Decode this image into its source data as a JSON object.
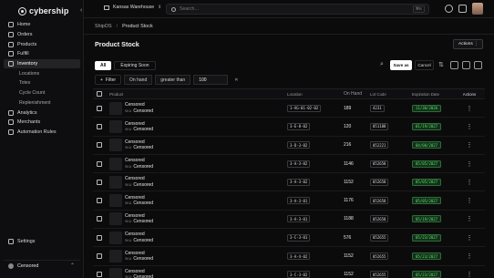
{
  "app": {
    "logo_text": "cybership",
    "collapse_icon": "chevron-left-icon"
  },
  "sidebar": {
    "items": [
      {
        "label": "Home",
        "icon": "home-icon"
      },
      {
        "label": "Orders",
        "icon": "orders-icon"
      },
      {
        "label": "Products",
        "icon": "box-icon"
      },
      {
        "label": "Fulfill",
        "icon": "truck-icon"
      },
      {
        "label": "Inventory",
        "icon": "inventory-icon",
        "active": true
      }
    ],
    "subitems": [
      "Locations",
      "Totes",
      "Cycle Count",
      "Replenishment"
    ],
    "items_after": [
      {
        "label": "Analytics",
        "icon": "analytics-icon"
      },
      {
        "label": "Merchants",
        "icon": "merchants-icon"
      },
      {
        "label": "Automation Rules",
        "icon": "automation-icon"
      }
    ],
    "settings_label": "Settings",
    "user_label": "Censored"
  },
  "topbar": {
    "warehouse": "Kansas Warehouse",
    "search_placeholder": "Search...",
    "shortcut": "⌘K"
  },
  "breadcrumb": {
    "root": "ShipOS",
    "sep": "/",
    "current": "Product Stock"
  },
  "page": {
    "title": "Product Stock",
    "actions_label": "Actions"
  },
  "tabs": [
    "All",
    "Expiring Soon"
  ],
  "toolbar": {
    "save_as": "Save as",
    "cancel": "Cancel"
  },
  "filter": {
    "button_label": "Filter",
    "field": "On hand",
    "operator": "greater than",
    "value": "100"
  },
  "table": {
    "headers": [
      "Product",
      "Location",
      "On Hand",
      "Lot Code",
      "Expiration Date",
      "Actions"
    ],
    "sku_label": "SKU",
    "rows": [
      {
        "name": "Censored",
        "sku": "Censored",
        "location": "1-AG-01-02-02",
        "on_hand": "189",
        "lot": "4231",
        "exp": "11/30/2026"
      },
      {
        "name": "Censored",
        "sku": "Censored",
        "location": "3-E-8-02",
        "on_hand": "120",
        "lot": "051188",
        "exp": "01/19/2027"
      },
      {
        "name": "Censored",
        "sku": "Censored",
        "location": "3-D-3-02",
        "on_hand": "216",
        "lot": "052221",
        "exp": "04/08/2027"
      },
      {
        "name": "Censored",
        "sku": "Censored",
        "location": "3-A-3-02",
        "on_hand": "1146",
        "lot": "052658",
        "exp": "05/05/2027"
      },
      {
        "name": "Censored",
        "sku": "Censored",
        "location": "3-A-3-02",
        "on_hand": "1152",
        "lot": "052658",
        "exp": "05/05/2027"
      },
      {
        "name": "Censored",
        "sku": "Censored",
        "location": "3-A-3-01",
        "on_hand": "1176",
        "lot": "052658",
        "exp": "05/05/2027"
      },
      {
        "name": "Censored",
        "sku": "Censored",
        "location": "3-A-3-01",
        "on_hand": "1188",
        "lot": "052658",
        "exp": "05/19/2027"
      },
      {
        "name": "Censored",
        "sku": "Censored",
        "location": "3-C-3-01",
        "on_hand": "576",
        "lot": "052655",
        "exp": "05/23/2027"
      },
      {
        "name": "Censored",
        "sku": "Censored",
        "location": "3-A-4-02",
        "on_hand": "1152",
        "lot": "052655",
        "exp": "05/23/2027"
      },
      {
        "name": "Censored",
        "sku": "Censored",
        "location": "3-C-3-02",
        "on_hand": "1152",
        "lot": "052655",
        "exp": "05/23/2027"
      }
    ]
  }
}
